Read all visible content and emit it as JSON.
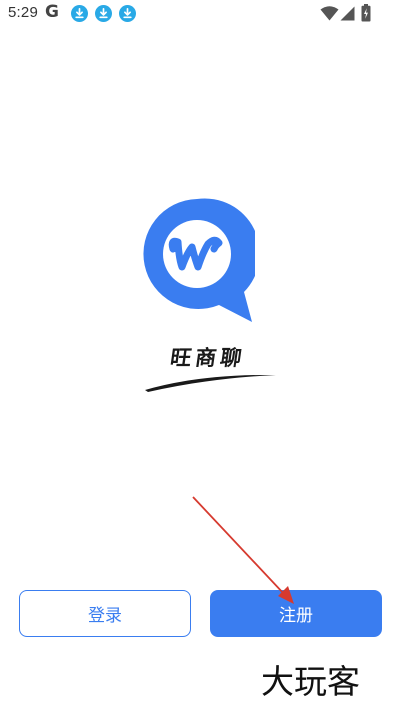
{
  "status_bar": {
    "time": "5:29",
    "google_letter": "G",
    "notification_icons": [
      "download-icon",
      "download-icon",
      "download-icon"
    ],
    "right_icons": [
      "wifi-icon",
      "signal-icon",
      "battery-icon"
    ],
    "accent_color": "#29a9e6"
  },
  "app": {
    "name": "旺商聊",
    "logo_letter": "w",
    "brand_color": "#3a7df0"
  },
  "buttons": {
    "login_label": "登录",
    "register_label": "注册"
  },
  "watermark": {
    "text": "大玩客"
  }
}
